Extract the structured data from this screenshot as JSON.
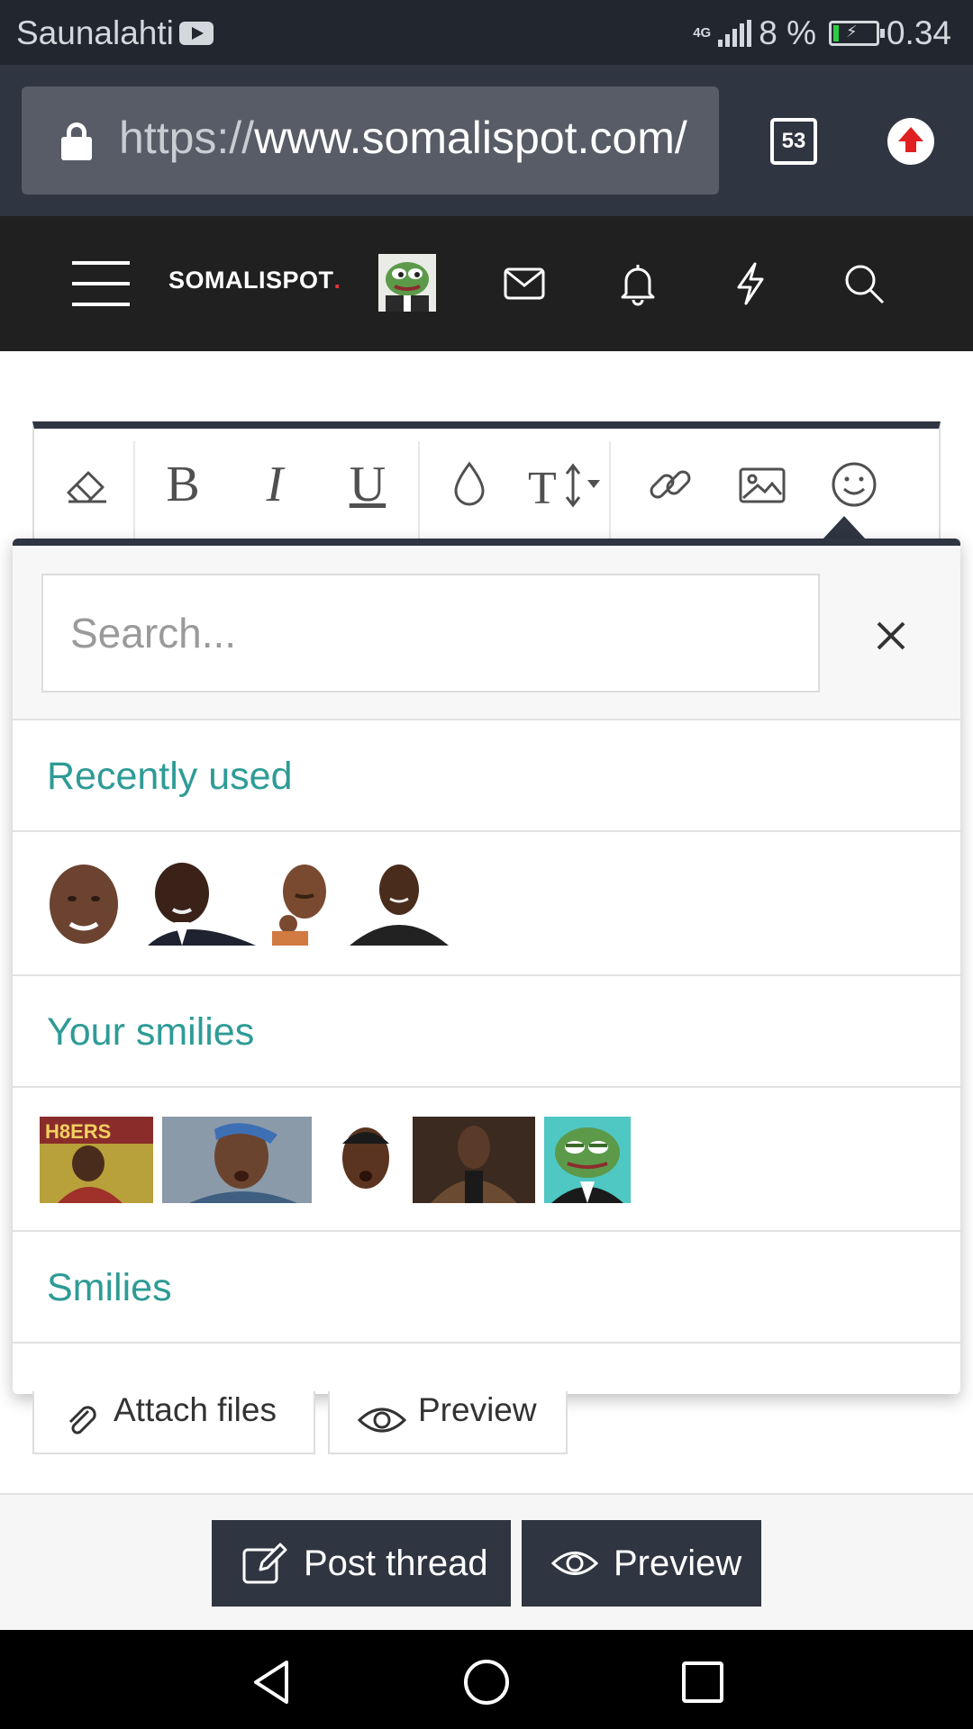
{
  "status_bar": {
    "carrier": "Saunalahti",
    "network": "4G",
    "battery": "8 %",
    "time": "0.34"
  },
  "browser": {
    "url_scheme": "https://",
    "url_host": "www.somalispot.com/",
    "tab_count": "53"
  },
  "site": {
    "logo": "SOMALISPOT",
    "logo_dot": "."
  },
  "smilie_picker": {
    "search_placeholder": "Search...",
    "sections": {
      "recent": "Recently used",
      "yours": "Your smilies",
      "all": "Smilies"
    },
    "recent_items": [
      "smilie-man-1",
      "smilie-man-2",
      "smilie-man-3",
      "smilie-man-4"
    ],
    "your_items": [
      "smilie-haters",
      "smilie-surprised-man",
      "smilie-durag-man",
      "smilie-coat-man",
      "smilie-pepe-tux"
    ]
  },
  "editor": {
    "attach_label": "Attach files",
    "preview_label": "Preview"
  },
  "footer": {
    "post_label": "Post thread",
    "preview_label": "Preview"
  },
  "colors": {
    "accent_teal": "#2e9b96",
    "header_dark": "#202020",
    "button_dark": "#2f3541"
  }
}
